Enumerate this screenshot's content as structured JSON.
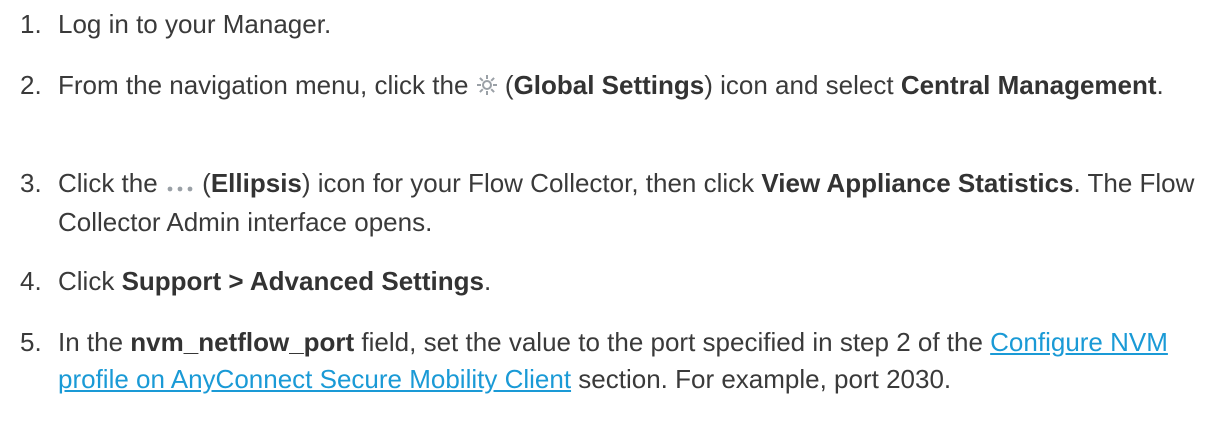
{
  "steps": [
    {
      "number": "1.",
      "parts": [
        "Log in to your Manager."
      ]
    },
    {
      "number": "2.",
      "parts": [
        "From the navigation menu, click the",
        "(",
        "Global Settings",
        ") icon and select ",
        "Central Management",
        "."
      ],
      "icon": "gear-icon"
    },
    {
      "number": "3.",
      "parts": [
        "Click the",
        "(",
        "Ellipsis",
        ") icon for your Flow Collector, then click ",
        "View Appliance Statistics",
        ". The Flow Collector Admin interface opens."
      ],
      "icon": "ellipsis-icon"
    },
    {
      "number": "4.",
      "parts": [
        "Click ",
        "Support > Advanced Settings",
        "."
      ]
    },
    {
      "number": "5.",
      "parts": [
        "In the ",
        "nvm_netflow_port",
        " field, set the value to the port specified in step 2 of the ",
        "Configure NVM profile on AnyConnect Secure Mobility Client",
        " section. For example, port 2030."
      ]
    }
  ],
  "colors": {
    "text": "#3a3a3a",
    "link": "#1a9ad6",
    "icon": "#9aa0a6"
  }
}
